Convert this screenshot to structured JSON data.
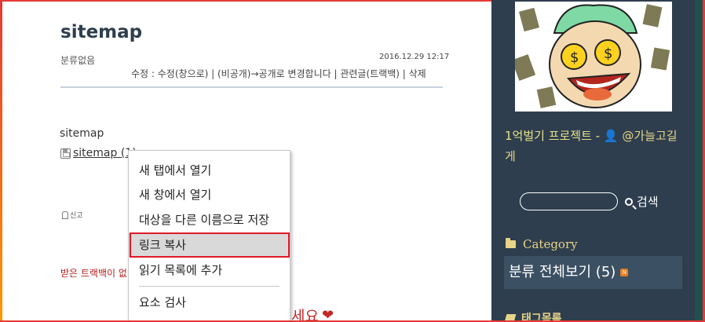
{
  "post": {
    "title": "sitemap",
    "category": "분류없음",
    "date": "2016.12.29 12:17",
    "actions": "수정 : 수정(창으로) | (비공개)→공개로 변경합니다 | 관련글(트랙백) | 삭제",
    "body_text": "sitemap",
    "attachment_label": "sitemap (1)",
    "report_label": "신고",
    "trackback_text": "받은 트랙백이 없",
    "like_tail": "세요"
  },
  "context_menu": {
    "items": [
      {
        "label": "새 탭에서 열기"
      },
      {
        "label": "새 창에서 열기"
      },
      {
        "label": "대상을 다른 이름으로 저장"
      },
      {
        "label": "링크 복사"
      },
      {
        "label": "읽기 목록에 추가"
      },
      {
        "label": "요소 검사"
      }
    ],
    "highlighted_index": 3
  },
  "sidebar": {
    "blog_title": "1억벌기 프로젝트 -",
    "author": "@가늘고길게",
    "search_label": "검색",
    "search_placeholder": "",
    "category_heading": "Category",
    "category_all": "분류 전체보기 (5)",
    "tag_heading": "태그목록"
  },
  "colors": {
    "sidebar_bg": "#2e3e4e",
    "accent_gold": "#e8d488",
    "highlight_border": "#e0192b",
    "title_color": "#2e3e4e"
  }
}
